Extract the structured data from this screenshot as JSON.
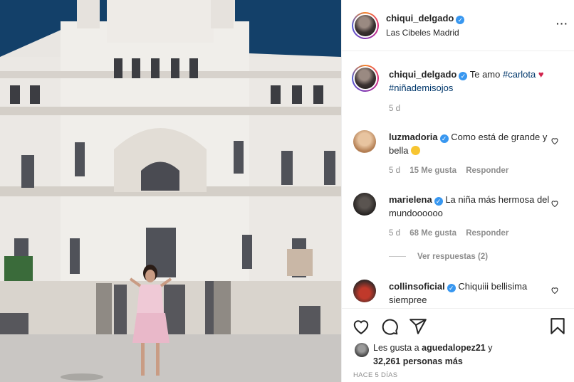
{
  "post": {
    "author": "chiqui_delgado",
    "location": "Las Cibeles Madrid",
    "caption_text": "Te amo",
    "caption_tag1": "#carlota",
    "caption_tag2": "#niñademisojos",
    "caption_time": "5 d"
  },
  "comments": [
    {
      "user": "luzmadoria",
      "text": "Como está de grande y bella",
      "time": "5 d",
      "likes": "15 Me gusta",
      "reply": "Responder"
    },
    {
      "user": "marielena",
      "text": "La niña más hermosa del mundoooooo",
      "time": "5 d",
      "likes": "68 Me gusta",
      "reply": "Responder"
    },
    {
      "user": "collinsoficial",
      "text": "Chiquiii bellisima siempree"
    }
  ],
  "view_replies": "Ver respuestas (2)",
  "likes_line": {
    "prefix": "Les gusta a",
    "user": "aguedalopez21",
    "connector": "y",
    "others": "32,261 personas más"
  },
  "timestamp": "HACE 5 DÍAS",
  "icons": [
    "heart-icon",
    "comment-icon",
    "share-icon",
    "bookmark-icon",
    "more-options-icon",
    "verified-badge-icon"
  ],
  "colors": {
    "link": "#00376b",
    "verified": "#3897f0",
    "muted": "#8e8e8e"
  }
}
